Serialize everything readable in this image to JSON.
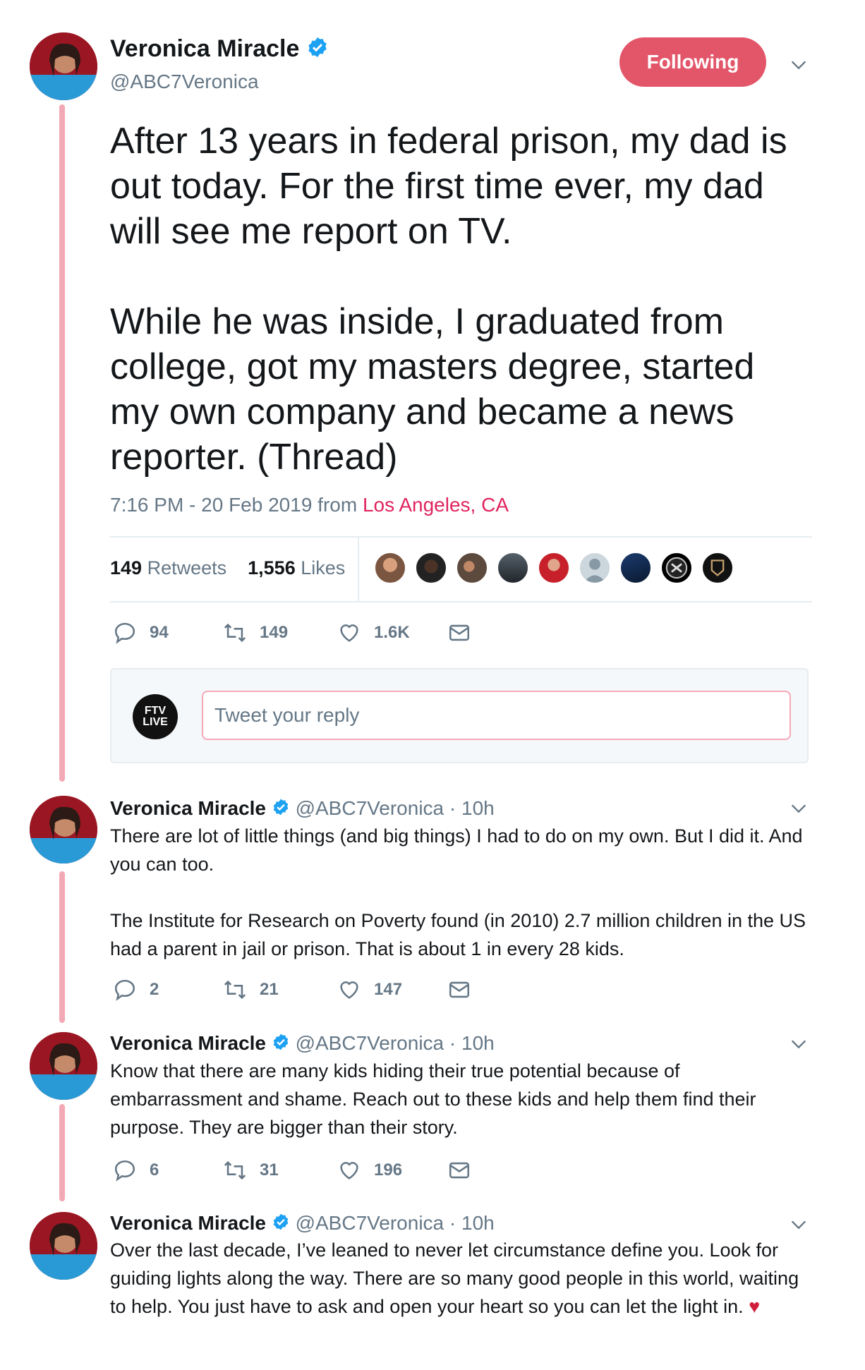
{
  "main": {
    "name": "Veronica Miracle",
    "handle": "@ABC7Veronica",
    "follow_label": "Following",
    "text": "After 13 years in federal prison, my dad is out today. For the first time ever, my dad will see me report on TV.\n\nWhile he was inside, I graduated from college, got my masters degree, started my own company and became a news reporter. (Thread)",
    "timestamp": "7:16 PM - 20 Feb 2019 from ",
    "location": "Los Angeles, CA",
    "retweets_count": "149",
    "retweets_label": " Retweets",
    "likes_count": "1,556",
    "likes_label": " Likes",
    "actions": {
      "replies": "94",
      "retweets": "149",
      "likes": "1.6K"
    },
    "likers_icons": [
      "avatar-1",
      "avatar-2",
      "avatar-3",
      "avatar-4",
      "avatar-5",
      "default-avatar",
      "avatar-7",
      "raiders-logo",
      "lafc-logo"
    ]
  },
  "reply_box": {
    "placeholder": "Tweet your reply",
    "avatar_text": "FTV LIVE"
  },
  "thread": [
    {
      "name": "Veronica Miracle",
      "handle": "@ABC7Veronica",
      "time": " · 10h",
      "text": "There are lot of little things (and big things) I had to do on my own. But I did it. And you can too.\n\nThe Institute for Research on Poverty found (in 2010) 2.7 million children in the US had a parent in jail or prison. That is about 1 in every 28 kids.",
      "replies": "2",
      "retweets": "21",
      "likes": "147"
    },
    {
      "name": "Veronica Miracle",
      "handle": "@ABC7Veronica",
      "time": " · 10h",
      "text": "Know that there are many kids hiding their true potential because of embarrassment and shame. Reach out to these kids and help them find their purpose. They are bigger than their story.",
      "replies": "6",
      "retweets": "31",
      "likes": "196"
    },
    {
      "name": "Veronica Miracle",
      "handle": "@ABC7Veronica",
      "time": " · 10h",
      "text": "Over the last decade, I’ve leaned to never let circumstance define you. Look for guiding lights along the way. There are so many good people in this world, waiting to help. You just have to ask and open your heart so you can let the light in. ",
      "heart": "♥"
    }
  ],
  "colors": {
    "accent": "#e0245e",
    "thread_line": "#f3a9b5",
    "verified": "#1da1f2",
    "muted": "#657786"
  }
}
